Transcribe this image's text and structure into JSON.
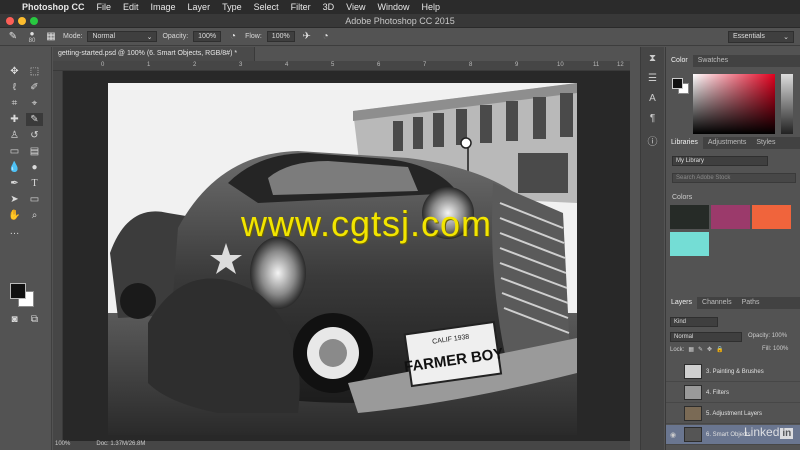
{
  "menubar": {
    "app": "Photoshop CC",
    "items": [
      "File",
      "Edit",
      "Image",
      "Layer",
      "Type",
      "Select",
      "Filter",
      "3D",
      "View",
      "Window",
      "Help"
    ]
  },
  "window": {
    "title": "Adobe Photoshop CC 2015"
  },
  "options": {
    "brush_size": "80",
    "mode_label": "Mode:",
    "mode_value": "Normal",
    "opacity_label": "Opacity:",
    "opacity_value": "100%",
    "flow_label": "Flow:",
    "flow_value": "100%",
    "workspace": "Essentials"
  },
  "document": {
    "tab_title": "getting-started.psd @ 100% (6. Smart Objects, RGB/8#) *",
    "ruler_ticks": [
      "0",
      "1",
      "2",
      "3",
      "4",
      "5",
      "6",
      "7",
      "8",
      "9",
      "10",
      "11",
      "12"
    ],
    "zoom": "100%",
    "doc_info": "Doc: 1.37M/26.8M",
    "plate_state": "CALIF 1938",
    "plate_text": "FARMER BOY",
    "watermark": "www.cgtsj.com"
  },
  "panels": {
    "color_tabs": [
      "Color",
      "Swatches"
    ],
    "library_tabs": [
      "Libraries",
      "Adjustments",
      "Styles"
    ],
    "library_select": "My Library",
    "search_placeholder": "Search Adobe Stock",
    "colors_label": "Colors",
    "swatches": [
      "#262b27",
      "#9b3a6b",
      "#f0643c",
      "#74ddd5"
    ],
    "layer_tabs": [
      "Layers",
      "Channels",
      "Paths"
    ],
    "kind": "Kind",
    "blend_mode": "Normal",
    "opacity_label": "Opacity:",
    "opacity_value": "100%",
    "lock_label": "Lock:",
    "fill_label": "Fill:",
    "fill_value": "100%",
    "layers": [
      "3. Painting & Brushes",
      "4. Filters",
      "5. Adjustment Layers",
      "6. Smart Objects"
    ],
    "linkedin": "Linked"
  }
}
